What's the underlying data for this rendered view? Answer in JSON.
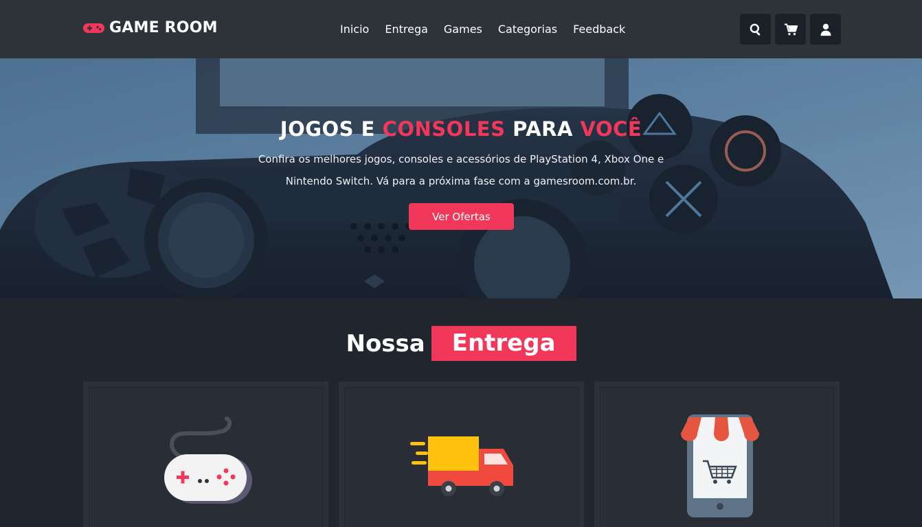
{
  "header": {
    "logo_text": "GAME ROOM",
    "logo_icon": "gamepad-icon",
    "nav": [
      {
        "label": "Inicio"
      },
      {
        "label": "Entrega"
      },
      {
        "label": "Games"
      },
      {
        "label": "Categorias"
      },
      {
        "label": "Feedback"
      }
    ],
    "icons": [
      "search-icon",
      "cart-icon",
      "user-icon"
    ]
  },
  "hero": {
    "title_part1": "JOGOS E ",
    "title_accent1": "CONSOLES",
    "title_part2": " PARA ",
    "title_accent2": "VOCÊ",
    "description": "Confira os melhores jogos, consoles e acessórios de PlayStation 4, Xbox One e Nintendo Switch. Vá para a próxima fase com a gamesroom.com.br.",
    "button_label": "Ver Ofertas"
  },
  "section": {
    "title_plain": "Nossa",
    "title_highlight": "Entrega"
  },
  "cards": [
    {
      "icon": "gamepad-icon"
    },
    {
      "icon": "delivery-truck-icon"
    },
    {
      "icon": "mobile-store-icon"
    }
  ],
  "colors": {
    "accent": "#f2385a",
    "header_bg": "#2e3239",
    "page_bg": "#20252e"
  }
}
